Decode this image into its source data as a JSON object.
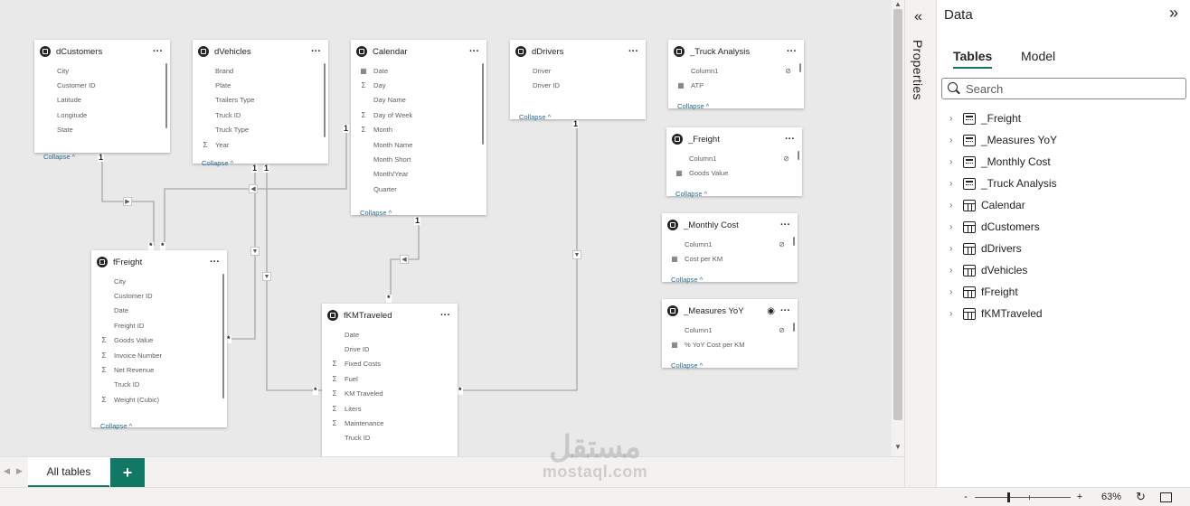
{
  "tables": [
    {
      "id": "dCustomers",
      "title": "dCustomers",
      "rows": [
        {
          "icon": "",
          "label": "City"
        },
        {
          "icon": "",
          "label": "Customer ID"
        },
        {
          "icon": "",
          "label": "Latitude"
        },
        {
          "icon": "",
          "label": "Longitude"
        },
        {
          "icon": "",
          "label": "State"
        }
      ],
      "collapse": "Collapse ^"
    },
    {
      "id": "dVehicles",
      "title": "dVehicles",
      "rows": [
        {
          "icon": "",
          "label": "Brand"
        },
        {
          "icon": "",
          "label": "Plate"
        },
        {
          "icon": "",
          "label": "Trailers Type"
        },
        {
          "icon": "",
          "label": "Truck ID"
        },
        {
          "icon": "",
          "label": "Truck Type"
        },
        {
          "icon": "Σ",
          "label": "Year"
        }
      ],
      "collapse": "Collapse ^"
    },
    {
      "id": "Calendar",
      "title": "Calendar",
      "rows": [
        {
          "icon": "▦",
          "label": "Date"
        },
        {
          "icon": "Σ",
          "label": "Day"
        },
        {
          "icon": "",
          "label": "Day Name"
        },
        {
          "icon": "Σ",
          "label": "Day of Week"
        },
        {
          "icon": "Σ",
          "label": "Month"
        },
        {
          "icon": "",
          "label": "Month Name"
        },
        {
          "icon": "",
          "label": "Month Short"
        },
        {
          "icon": "",
          "label": "Month/Year"
        },
        {
          "icon": "",
          "label": "Quarter"
        }
      ],
      "collapse": "Collapse ^"
    },
    {
      "id": "dDrivers",
      "title": "dDrivers",
      "rows": [
        {
          "icon": "",
          "label": "Driver"
        },
        {
          "icon": "",
          "label": "Driver ID"
        }
      ],
      "collapse": "Collapse ^"
    },
    {
      "id": "TruckAnalysis",
      "title": "_Truck Analysis",
      "rows": [
        {
          "icon": "",
          "label": "Column1",
          "hidden": true
        },
        {
          "icon": "▦",
          "label": "ATP"
        }
      ],
      "collapse": "Collapse ^"
    },
    {
      "id": "Freight",
      "title": "_Freight",
      "rows": [
        {
          "icon": "",
          "label": "Column1",
          "hidden": true
        },
        {
          "icon": "▦",
          "label": "Goods Value"
        }
      ],
      "collapse": "Collapse ^"
    },
    {
      "id": "MonthlyCost",
      "title": "_Monthly Cost",
      "rows": [
        {
          "icon": "",
          "label": "Column1",
          "hidden": true
        },
        {
          "icon": "▦",
          "label": "Cost per KM"
        }
      ],
      "collapse": "Collapse ^"
    },
    {
      "id": "MeasuresYoY",
      "title": "_Measures YoY",
      "rows": [
        {
          "icon": "",
          "label": "Column1",
          "hidden": true
        },
        {
          "icon": "▦",
          "label": "% YoY Cost per KM"
        }
      ],
      "collapse": "Collapse ^"
    },
    {
      "id": "fFreight",
      "title": "fFreight",
      "rows": [
        {
          "icon": "",
          "label": "City"
        },
        {
          "icon": "",
          "label": "Customer ID"
        },
        {
          "icon": "",
          "label": "Date"
        },
        {
          "icon": "",
          "label": "Freight ID"
        },
        {
          "icon": "Σ",
          "label": "Goods Value"
        },
        {
          "icon": "Σ",
          "label": "Invoice Number"
        },
        {
          "icon": "Σ",
          "label": "Net Revenue"
        },
        {
          "icon": "",
          "label": "Truck ID"
        },
        {
          "icon": "Σ",
          "label": "Weight (Cubic)"
        }
      ],
      "collapse": "Collapse ^"
    },
    {
      "id": "fKMTraveled",
      "title": "fKMTraveled",
      "rows": [
        {
          "icon": "",
          "label": "Date"
        },
        {
          "icon": "",
          "label": "Drive ID"
        },
        {
          "icon": "Σ",
          "label": "Fixed Costs"
        },
        {
          "icon": "Σ",
          "label": "Fuel"
        },
        {
          "icon": "Σ",
          "label": "KM Traveled"
        },
        {
          "icon": "Σ",
          "label": "Liters"
        },
        {
          "icon": "Σ",
          "label": "Maintenance"
        },
        {
          "icon": "",
          "label": "Truck ID"
        }
      ],
      "collapse": ""
    }
  ],
  "markers": {
    "one": "1",
    "many": "*"
  },
  "bottom": {
    "tab_label": "All tables",
    "add_label": "+"
  },
  "properties": {
    "label": "Properties"
  },
  "data_pane": {
    "title": "Data",
    "tabs": [
      "Tables",
      "Model"
    ],
    "search_placeholder": "Search",
    "items": [
      {
        "label": "_Freight",
        "icon": "calculator-table-icon"
      },
      {
        "label": "_Measures YoY",
        "icon": "calculator-table-icon"
      },
      {
        "label": "_Monthly Cost",
        "icon": "calculator-table-icon"
      },
      {
        "label": "_Truck Analysis",
        "icon": "calculator-table-icon"
      },
      {
        "label": "Calendar",
        "icon": "table-icon"
      },
      {
        "label": "dCustomers",
        "icon": "table-icon"
      },
      {
        "label": "dDrivers",
        "icon": "table-icon"
      },
      {
        "label": "dVehicles",
        "icon": "table-icon"
      },
      {
        "label": "fFreight",
        "icon": "table-icon"
      },
      {
        "label": "fKMTraveled",
        "icon": "table-icon"
      }
    ]
  },
  "zoom": {
    "value": "63%",
    "minus": "-",
    "plus": "+"
  },
  "watermark": {
    "arabic": "مستقل",
    "latin": "mostaql.com"
  }
}
